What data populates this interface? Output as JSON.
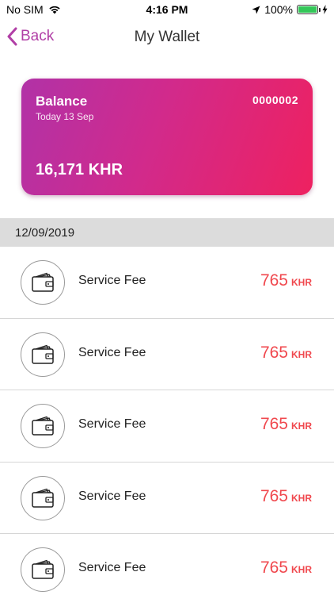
{
  "status_bar": {
    "carrier": "No SIM",
    "time": "4:16 PM",
    "battery": "100%",
    "battery_level": 1.0
  },
  "nav": {
    "back_label": "Back",
    "title": "My Wallet"
  },
  "card": {
    "title": "Balance",
    "date": "Today 13 Sep",
    "number": "0000002",
    "amount": "16,171 KHR"
  },
  "date_header": "12/09/2019",
  "transactions": [
    {
      "label": "Service Fee",
      "amount": "765",
      "currency": "KHR",
      "icon": "wallet-icon"
    },
    {
      "label": "Service Fee",
      "amount": "765",
      "currency": "KHR",
      "icon": "wallet-icon"
    },
    {
      "label": "Service Fee",
      "amount": "765",
      "currency": "KHR",
      "icon": "wallet-icon"
    },
    {
      "label": "Service Fee",
      "amount": "765",
      "currency": "KHR",
      "icon": "wallet-icon"
    },
    {
      "label": "Service Fee",
      "amount": "765",
      "currency": "KHR",
      "icon": "wallet-icon"
    }
  ],
  "colors": {
    "accent": "#b13fa6",
    "card_gradient_start": "#b132a7",
    "card_gradient_end": "#ee2160",
    "amount": "#f0484e",
    "battery": "#34c759"
  }
}
